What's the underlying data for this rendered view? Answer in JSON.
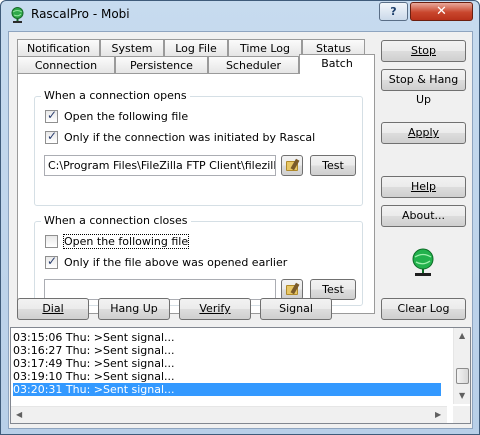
{
  "window": {
    "title": "RascalPro - Mobi",
    "help_glyph": "?",
    "close_glyph": "✕"
  },
  "tabs": {
    "row1": [
      "Notification",
      "System",
      "Log File",
      "Time Log",
      "Status"
    ],
    "row2": [
      "Connection",
      "Persistence",
      "Scheduler",
      "Batch"
    ],
    "active": "Batch"
  },
  "open_group": {
    "title": "When a connection opens",
    "open_file_label": "Open the following file",
    "open_file_checked": true,
    "only_initiated_label": "Only if the connection was initiated by Rascal",
    "only_initiated_checked": true,
    "file_path": "C:\\Program Files\\FileZilla FTP Client\\filezilla.exe",
    "test_label": "Test"
  },
  "close_group": {
    "title": "When a connection closes",
    "open_file_label": "Open the following file",
    "open_file_checked": false,
    "only_opened_label": "Only if the file above was opened earlier",
    "only_opened_checked": true,
    "file_path": "",
    "test_label": "Test"
  },
  "right_buttons": {
    "stop": "Stop",
    "stop_hang_up": "Stop & Hang Up",
    "apply": "Apply",
    "help": "Help",
    "about": "About..."
  },
  "bottom_buttons": {
    "dial": "Dial",
    "hang_up": "Hang Up",
    "verify": "Verify",
    "signal": "Signal",
    "clear_log": "Clear Log"
  },
  "log_entries": [
    "03:15:06 Thu: >Sent signal...",
    "03:16:27 Thu: >Sent signal...",
    "03:17:49 Thu: >Sent signal...",
    "03:19:10 Thu: >Sent signal...",
    "03:20:31 Thu: >Sent signal..."
  ],
  "selected_log_index": 4,
  "colors": {
    "selection": "#3399ff",
    "status_icon": "#22b14c",
    "close_button": "#c9462d"
  },
  "icons": [
    "app-globe-icon",
    "folder-browse-icon",
    "network-status-icon"
  ]
}
